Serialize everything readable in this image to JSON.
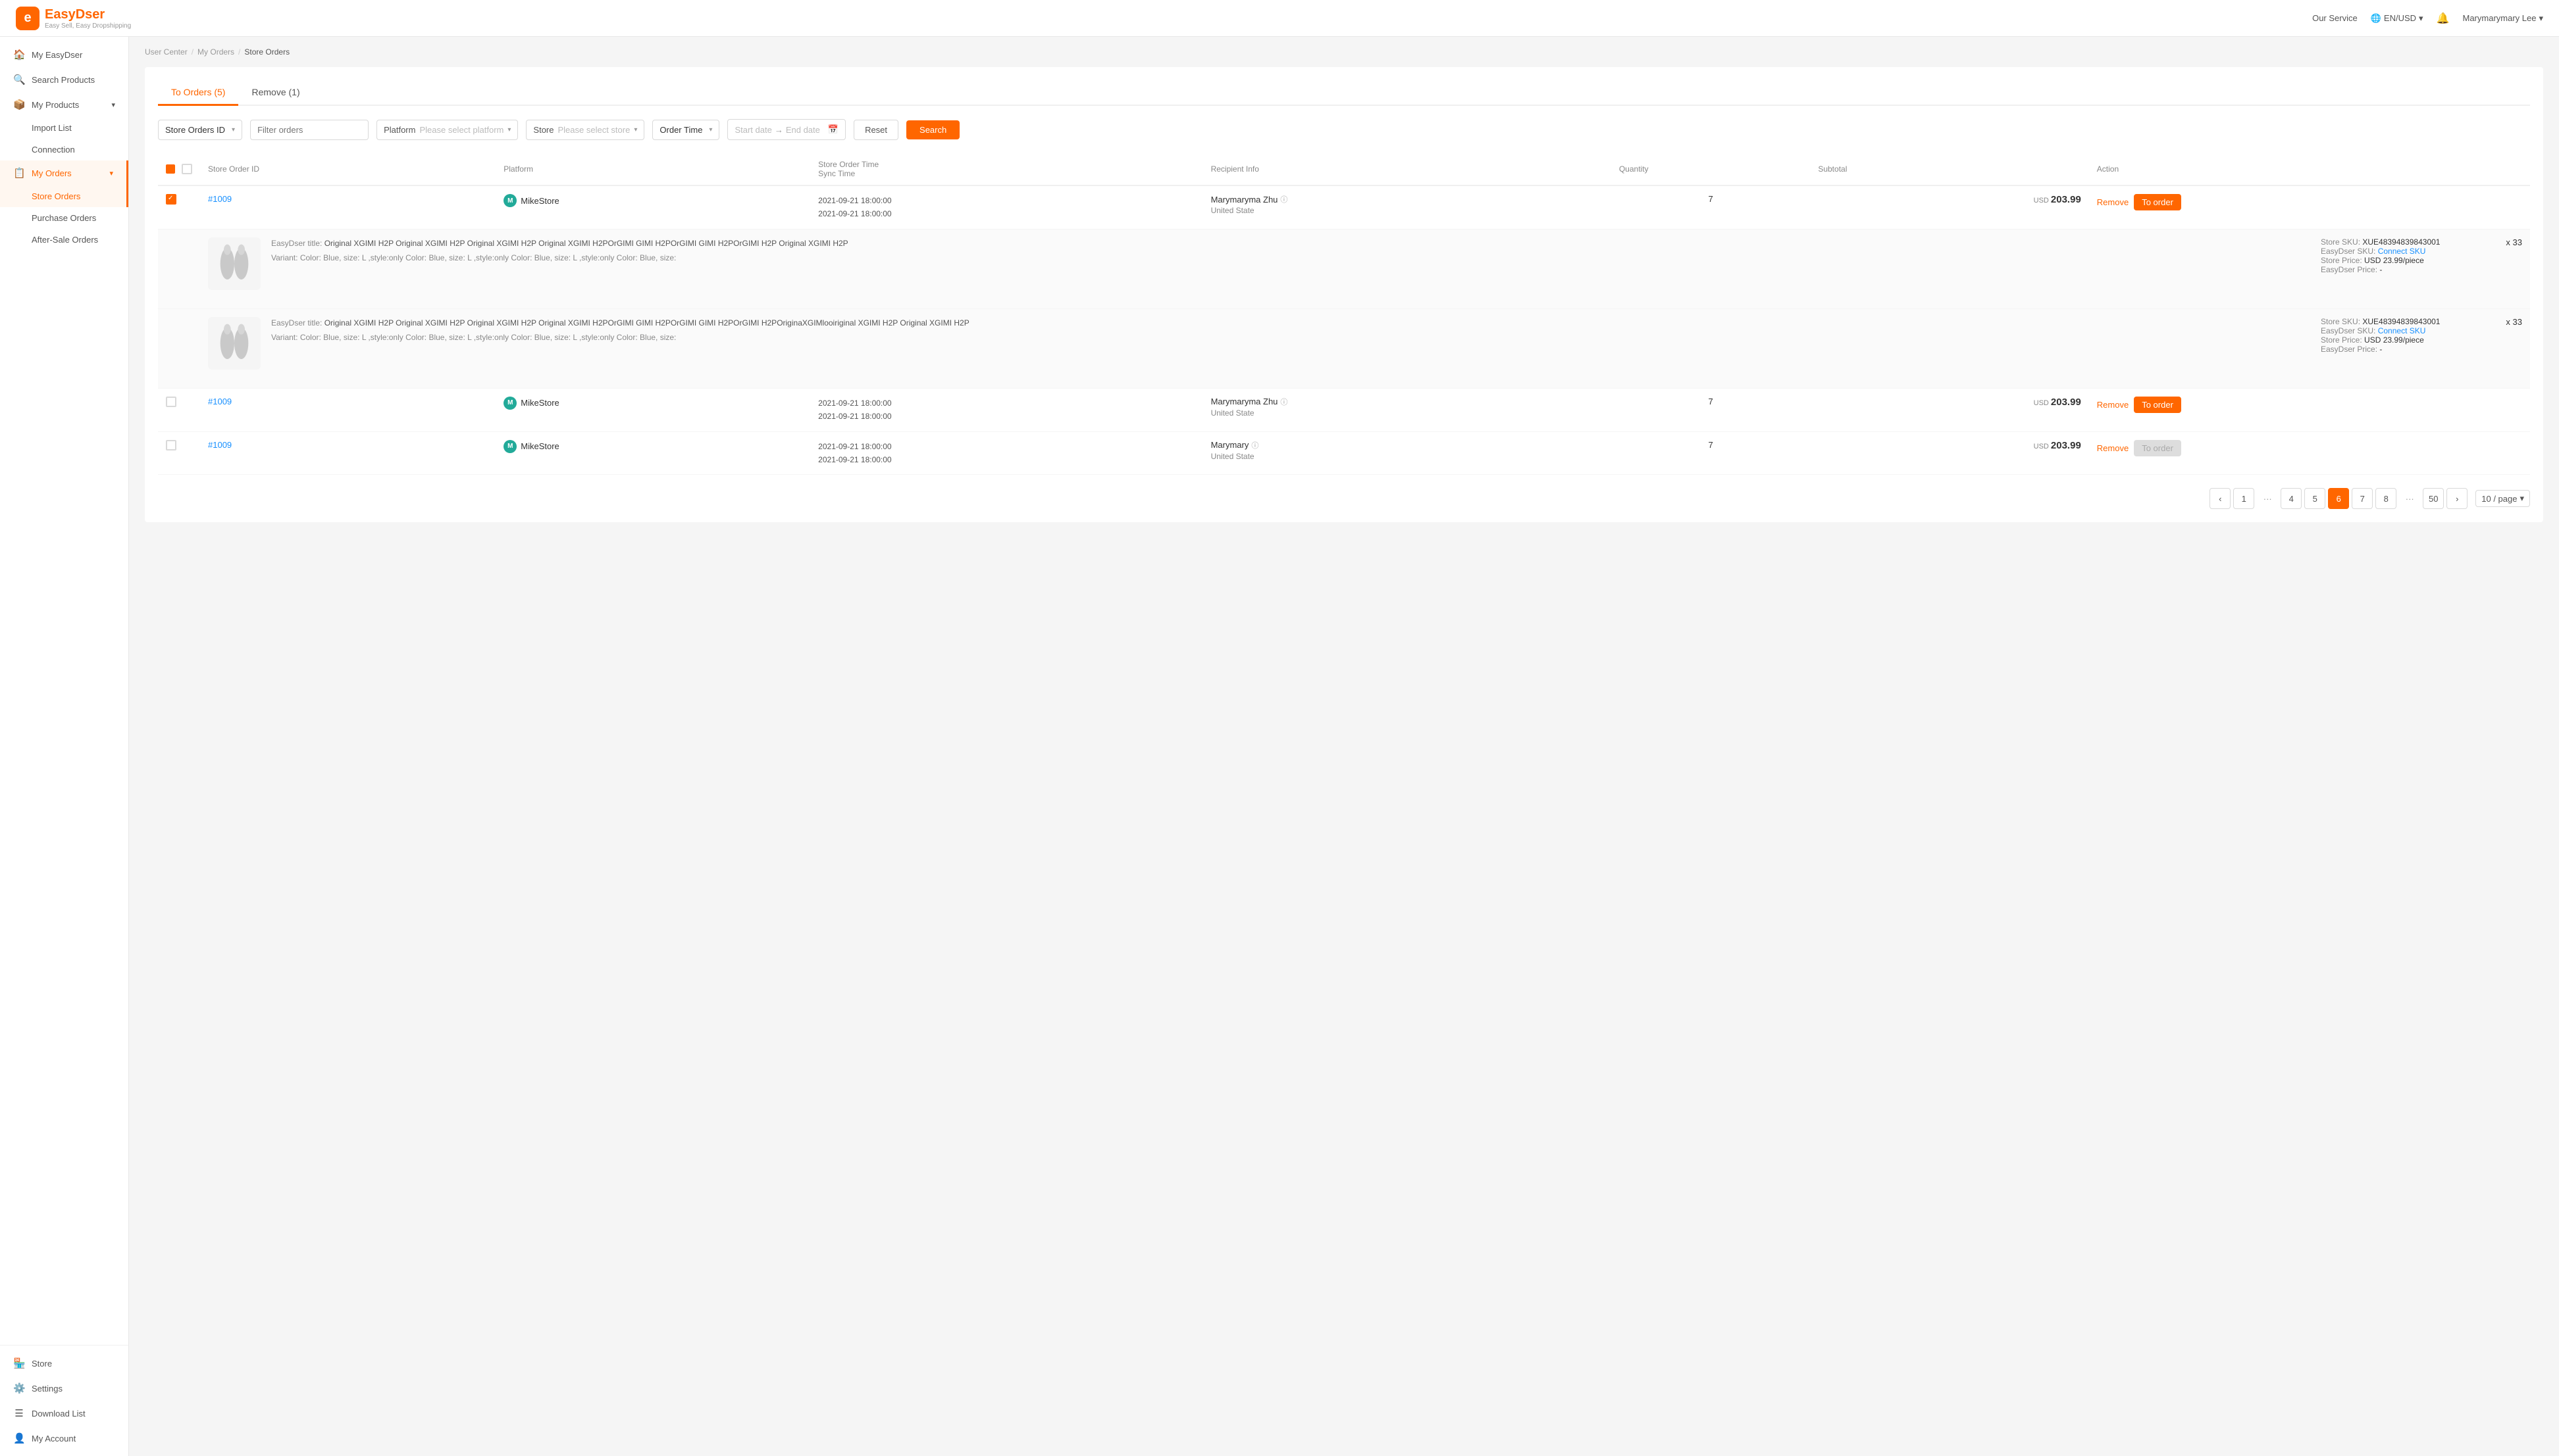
{
  "header": {
    "logo_letter": "e",
    "logo_name": "EasyDser",
    "logo_sub": "Easy Sell, Easy Dropshipping",
    "service_label": "Our Service",
    "lang_label": "EN/USD",
    "user_name": "Marymarymary Lee"
  },
  "sidebar": {
    "items": [
      {
        "id": "my-easydser",
        "icon": "🏠",
        "label": "My EasyDser",
        "active": false
      },
      {
        "id": "search-products",
        "icon": "🔍",
        "label": "Search Products",
        "active": false
      },
      {
        "id": "my-products",
        "icon": "📦",
        "label": "My Products",
        "active": false,
        "has_sub": true
      },
      {
        "id": "import-list",
        "label": "Import List",
        "sub": true,
        "active": false
      },
      {
        "id": "connection",
        "label": "Connection",
        "sub": true,
        "active": false
      },
      {
        "id": "my-orders",
        "icon": "📋",
        "label": "My Orders",
        "active": true,
        "has_sub": true
      },
      {
        "id": "store-orders",
        "label": "Store Orders",
        "sub": true,
        "active": true
      },
      {
        "id": "purchase-orders",
        "label": "Purchase Orders",
        "sub": true,
        "active": false
      },
      {
        "id": "after-sale-orders",
        "label": "After-Sale Orders",
        "sub": true,
        "active": false
      }
    ],
    "bottom_items": [
      {
        "id": "store",
        "icon": "🏪",
        "label": "Store"
      },
      {
        "id": "settings",
        "icon": "⚙️",
        "label": "Settings"
      },
      {
        "id": "download-list",
        "icon": "☰",
        "label": "Download List"
      },
      {
        "id": "my-account",
        "icon": "👤",
        "label": "My Account"
      }
    ]
  },
  "breadcrumb": {
    "items": [
      "User Center",
      "My Orders",
      "Store Orders"
    ]
  },
  "tabs": [
    {
      "id": "to-orders",
      "label": "To Orders (5)",
      "active": true
    },
    {
      "id": "remove",
      "label": "Remove (1)",
      "active": false
    }
  ],
  "filters": {
    "order_id_label": "Store Orders ID",
    "filter_placeholder": "Filter orders",
    "platform_label": "Platform",
    "platform_placeholder": "Please select platform",
    "store_label": "Store",
    "store_placeholder": "Please select store",
    "order_time_label": "Order Time",
    "start_date": "Start date",
    "end_date": "End date",
    "reset_label": "Reset",
    "search_label": "Search"
  },
  "table": {
    "headers": [
      "",
      "",
      "Store Order ID",
      "Platform",
      "Store Order Time / Sync Time",
      "Recipient Info",
      "Quantity",
      "Subtotal",
      "Action"
    ],
    "rows": [
      {
        "id": "#1009",
        "checked": true,
        "platform": "MikeStore",
        "platform_icon": "M",
        "order_time": "2021-09-21 18:00:00",
        "sync_time": "2021-09-21 18:00:00",
        "recipient_name": "Marymaryma Zhu",
        "recipient_country": "United State",
        "quantity": 7,
        "subtotal_currency": "USD",
        "subtotal_amount": "203.99",
        "has_remove": true,
        "has_to_order": true,
        "to_order_disabled": false,
        "products": [
          {
            "title": "Original XGIMI H2P Original XGIMI H2P Original XGIMI H2P Original XGIMI H2POrGIMI GIMI H2POrGIMI GIMI H2POrGIMI H2P Original XGIMI H2P",
            "variant": "Color: Blue, size: L ,style:only Color: Blue, size: L ,style:only Color: Blue, size: L ,style:only Color: Blue, size:",
            "store_sku": "XUE48394839843001",
            "easydser_sku_label": "Connect SKU",
            "store_price": "USD 23.99/piece",
            "easydser_price": "-",
            "quantity": 33
          },
          {
            "title": "Original XGIMI H2P Original XGIMI H2P Original XGIMI H2P Original XGIMI H2POrGIMI GIMI H2POrGIMI GIMI H2POrGIMI H2POriginaXGIMlooiriginal XGIMI H2P Original XGIMI H2P",
            "variant": "Color: Blue, size: L ,style:only Color: Blue, size: L ,style:only Color: Blue, size: L ,style:only Color: Blue, size:",
            "store_sku": "XUE48394839843001",
            "easydser_sku_label": "Connect SKU",
            "store_price": "USD 23.99/piece",
            "easydser_price": "-",
            "quantity": 33
          }
        ]
      },
      {
        "id": "#1009",
        "checked": false,
        "platform": "MikeStore",
        "platform_icon": "M",
        "order_time": "2021-09-21 18:00:00",
        "sync_time": "2021-09-21 18:00:00",
        "recipient_name": "Marymaryma Zhu",
        "recipient_country": "United State",
        "quantity": 7,
        "subtotal_currency": "USD",
        "subtotal_amount": "203.99",
        "has_remove": true,
        "has_to_order": true,
        "to_order_disabled": false,
        "products": []
      },
      {
        "id": "#1009",
        "checked": false,
        "platform": "MikeStore",
        "platform_icon": "M",
        "order_time": "2021-09-21 18:00:00",
        "sync_time": "2021-09-21 18:00:00",
        "recipient_name": "Marymary",
        "recipient_country": "United State",
        "quantity": 7,
        "subtotal_currency": "USD",
        "subtotal_amount": "203.99",
        "has_remove": true,
        "has_to_order": true,
        "to_order_disabled": true,
        "products": []
      }
    ]
  },
  "pagination": {
    "pages": [
      1,
      "...",
      4,
      5,
      6,
      7,
      8,
      "...",
      50
    ],
    "current": 6,
    "per_page": "10 / page"
  },
  "labels": {
    "easydser_title": "EasyDser title:",
    "variant_label": "Variant:",
    "store_sku_label": "Store SKU:",
    "easydser_sku_label": "EasyDser SKU:",
    "store_price_label": "Store Price:",
    "easydser_price_label": "EasyDser Price:"
  }
}
